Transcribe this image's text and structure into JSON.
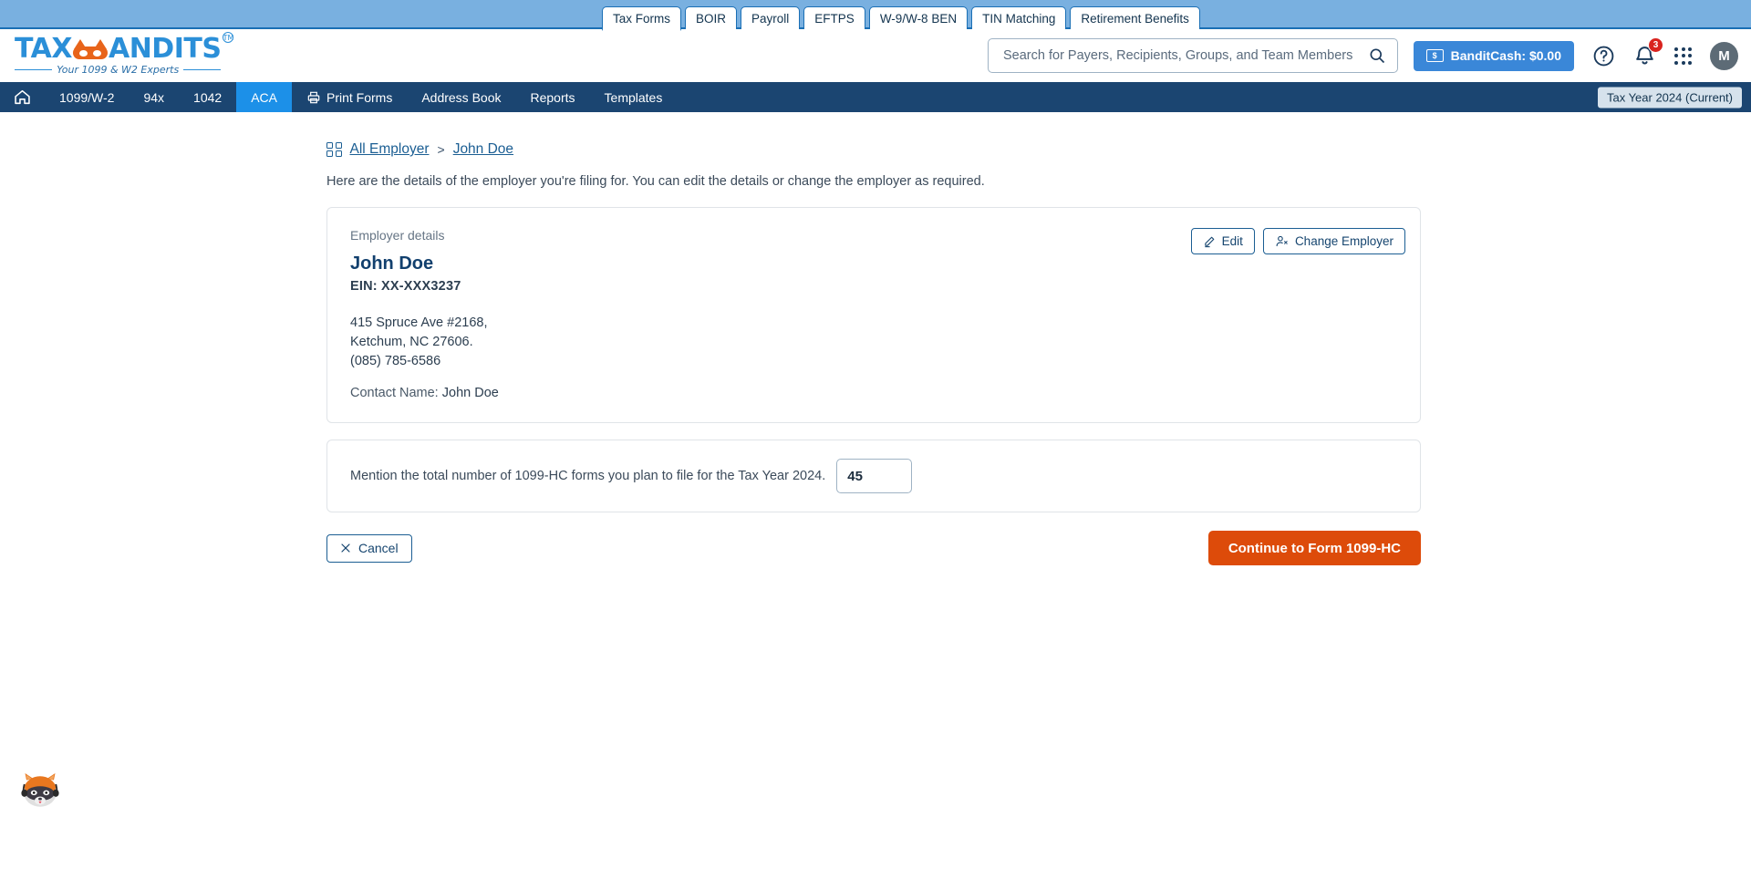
{
  "top_tabs": [
    {
      "label": "Tax Forms",
      "active": true
    },
    {
      "label": "BOIR",
      "active": false
    },
    {
      "label": "Payroll",
      "active": false
    },
    {
      "label": "EFTPS",
      "active": false
    },
    {
      "label": "W-9/W-8 BEN",
      "active": false
    },
    {
      "label": "TIN Matching",
      "active": false
    },
    {
      "label": "Retirement Benefits",
      "active": false
    }
  ],
  "logo": {
    "text_left": "TAX",
    "text_right": "ANDITS",
    "tm": "TM",
    "tagline": "Your 1099 & W2 Experts"
  },
  "search": {
    "placeholder": "Search for Payers, Recipients, Groups, and Team Members",
    "value": "",
    "icon": "search-icon"
  },
  "header_right": {
    "bandit_cash_label": "BanditCash: $0.00",
    "bandit_cash_icon": "cash-icon",
    "help_icon": "question-circle-icon",
    "bell_icon": "bell-icon",
    "notification_count": "3",
    "apps_icon": "apps-grid-icon",
    "avatar_initial": "M"
  },
  "nav": {
    "home_icon": "home-icon",
    "items": [
      {
        "label": "1099/W-2",
        "active": false,
        "icon": null
      },
      {
        "label": "94x",
        "active": false,
        "icon": null
      },
      {
        "label": "1042",
        "active": false,
        "icon": null
      },
      {
        "label": "ACA",
        "active": true,
        "icon": null
      },
      {
        "label": "Print Forms",
        "active": false,
        "icon": "printer-icon"
      },
      {
        "label": "Address Book",
        "active": false,
        "icon": null
      },
      {
        "label": "Reports",
        "active": false,
        "icon": null
      },
      {
        "label": "Templates",
        "active": false,
        "icon": null
      }
    ],
    "tax_year": "Tax Year 2024 (Current)"
  },
  "breadcrumb": {
    "grid_icon": "grid-icon",
    "items": [
      "All Employer",
      "John Doe"
    ],
    "separator": ">"
  },
  "page": {
    "subtitle": "Here are the details of the employer you're filing for. You can edit the details or change the employer as required."
  },
  "employer": {
    "section_label": "Employer details",
    "name": "John Doe",
    "ein": "EIN: XX-XXX3237",
    "address_line1": "415 Spruce Ave #2168,",
    "address_line2": "Ketchum, NC 27606.",
    "phone": "(085) 785-6586",
    "contact_label": "Contact Name:",
    "contact_name": "John Doe",
    "edit_label": "Edit",
    "edit_icon": "pencil-icon",
    "change_employer_label": "Change Employer",
    "change_employer_icon": "user-switch-icon"
  },
  "form_count": {
    "label": "Mention the total number of 1099-HC forms you plan to file for the Tax Year 2024.",
    "value": "45"
  },
  "footer": {
    "cancel_label": "Cancel",
    "cancel_icon": "close-icon",
    "continue_label": "Continue to Form 1099-HC"
  },
  "mascot": {
    "name": "raccoon-mascot"
  },
  "colors": {
    "tab_band": "#79b0e0",
    "navbar": "#1b4571",
    "nav_active": "#1c90e8",
    "primary_orange": "#dd4b0a",
    "link_blue": "#1b5e93",
    "bandit_cash_blue": "#3a87d8",
    "badge_red": "#d9231f"
  }
}
